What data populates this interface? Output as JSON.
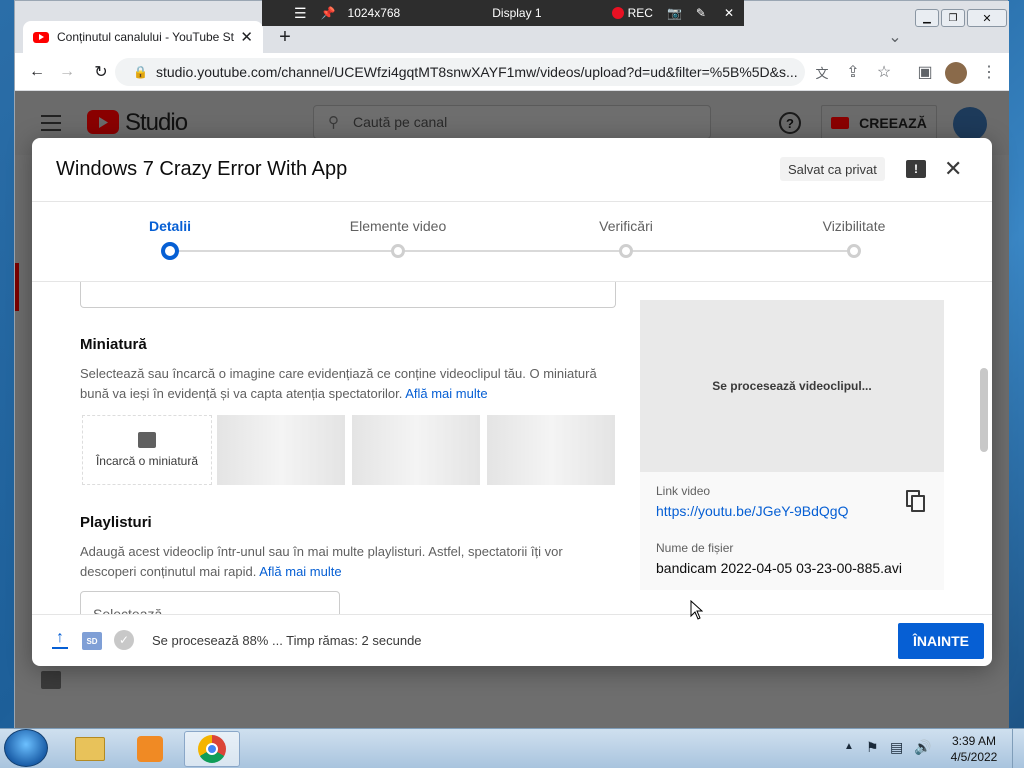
{
  "recorder": {
    "resolution": "1024x768",
    "display": "Display 1",
    "rec": "REC"
  },
  "browser": {
    "tab_title": "Conținutul canalului - YouTube St",
    "new_tab": "+",
    "url": "studio.youtube.com/channel/UCEWfzi4gqtMT8snwXAYF1mw/videos/upload?d=ud&filter=%5B%5D&s..."
  },
  "studio": {
    "logo_text": "Studio",
    "search_placeholder": "Caută pe canal",
    "create_label": "CREEAZĂ"
  },
  "dialog": {
    "title": "Windows 7 Crazy Error With App",
    "saved_badge": "Salvat ca privat",
    "steps": [
      {
        "label": "Detalii",
        "active": true
      },
      {
        "label": "Elemente video",
        "active": false
      },
      {
        "label": "Verificări",
        "active": false
      },
      {
        "label": "Vizibilitate",
        "active": false
      }
    ],
    "thumbnail": {
      "title": "Miniatură",
      "desc": "Selectează sau încarcă o imagine care evidențiază ce conține videoclipul tău. O miniatură bună va ieși în evidență și va capta atenția spectatorilor.",
      "link": "Află mai multe",
      "upload_label": "Încarcă o miniatură"
    },
    "playlists": {
      "title": "Playlisturi",
      "desc": "Adaugă acest videoclip într-unul sau în mai multe playlisturi. Astfel, spectatorii îți vor descoperi conținutul mai rapid.",
      "link": "Află mai multe",
      "select_placeholder": "Selectează"
    },
    "preview": {
      "processing": "Se procesează videoclipul...",
      "link_label": "Link video",
      "link_url": "https://youtu.be/JGeY-9BdQgQ",
      "filename_label": "Nume de fișier",
      "filename": "bandicam 2022-04-05 03-23-00-885.avi"
    },
    "footer": {
      "status": "Se procesează 88% ... Timp rămas: 2 secunde",
      "next_label": "ÎNAINTE",
      "hd_badge": "SD"
    }
  },
  "taskbar": {
    "time": "3:39 AM",
    "date": "4/5/2022"
  },
  "colors": {
    "accent": "#065fd4",
    "brand_red": "#ff0000",
    "rec_red": "#e81123"
  }
}
